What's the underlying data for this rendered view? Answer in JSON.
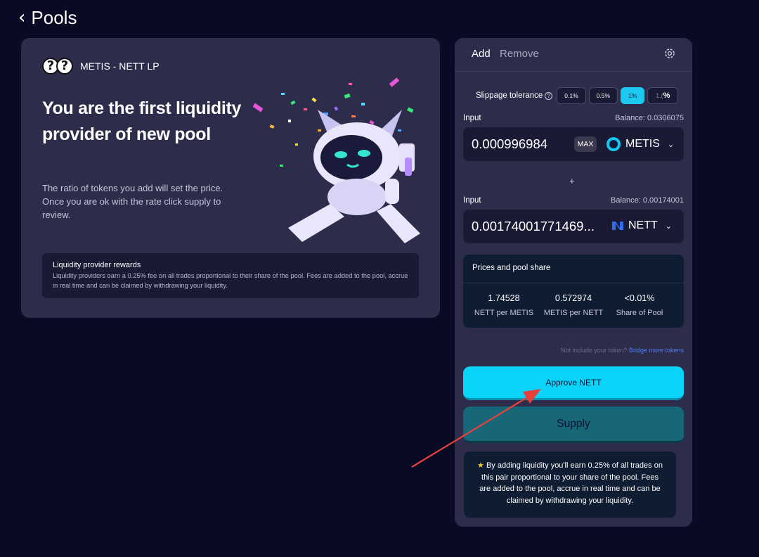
{
  "header": {
    "back_label": "Pools"
  },
  "pool_card": {
    "pair_label": "METIS - NETT LP",
    "hero_title": "You are the first liquidity provider of new pool",
    "hero_desc": "The ratio of tokens you add will set the price. Once you are ok with the rate click supply to review.",
    "rewards_title": "Liquidity provider rewards",
    "rewards_text": "Liquidity providers earn a 0.25% fee on all trades proportional to their share of the pool. Fees are added to the pool, accrue in real time and can be claimed by withdrawing your liquidity."
  },
  "panel": {
    "tab_add": "Add",
    "tab_remove": "Remove",
    "slippage_label": "Slippage tolerance",
    "slippage_options": [
      "0.1%",
      "0.5%",
      "1%"
    ],
    "slippage_selected": "1%",
    "slippage_custom_placeholder": "1.(",
    "slippage_custom_suffix": "%",
    "input1": {
      "label": "Input",
      "balance": "Balance: 0.0306075",
      "amount": "0.000996984",
      "max_label": "MAX",
      "token": "METIS"
    },
    "plus": "+",
    "input2": {
      "label": "Input",
      "balance": "Balance: 0.00174001",
      "amount": "0.00174001771469...",
      "token": "NETT"
    },
    "prices": {
      "title": "Prices and pool share",
      "stats": [
        {
          "value": "1.74528",
          "label": "NETT per METIS"
        },
        {
          "value": "0.572974",
          "label": "METIS per NETT"
        },
        {
          "value": "<0.01%",
          "label": "Share of Pool"
        }
      ]
    },
    "bridge_text": "Not include your token?",
    "bridge_link": "Bridge more tokens",
    "approve_label": "Approve NETT",
    "supply_label": "Supply",
    "note_text": "By adding liquidity you'll earn 0.25% of all trades on this pair proportional to your share of the pool. Fees are added to the pool, accrue in real time and can be claimed by withdrawing your liquidity."
  },
  "colors": {
    "background": "#090a24",
    "card": "#2d2c4b",
    "accent": "#0bd4fb",
    "supply": "#176779",
    "annotation_arrow": "#e8403a"
  }
}
